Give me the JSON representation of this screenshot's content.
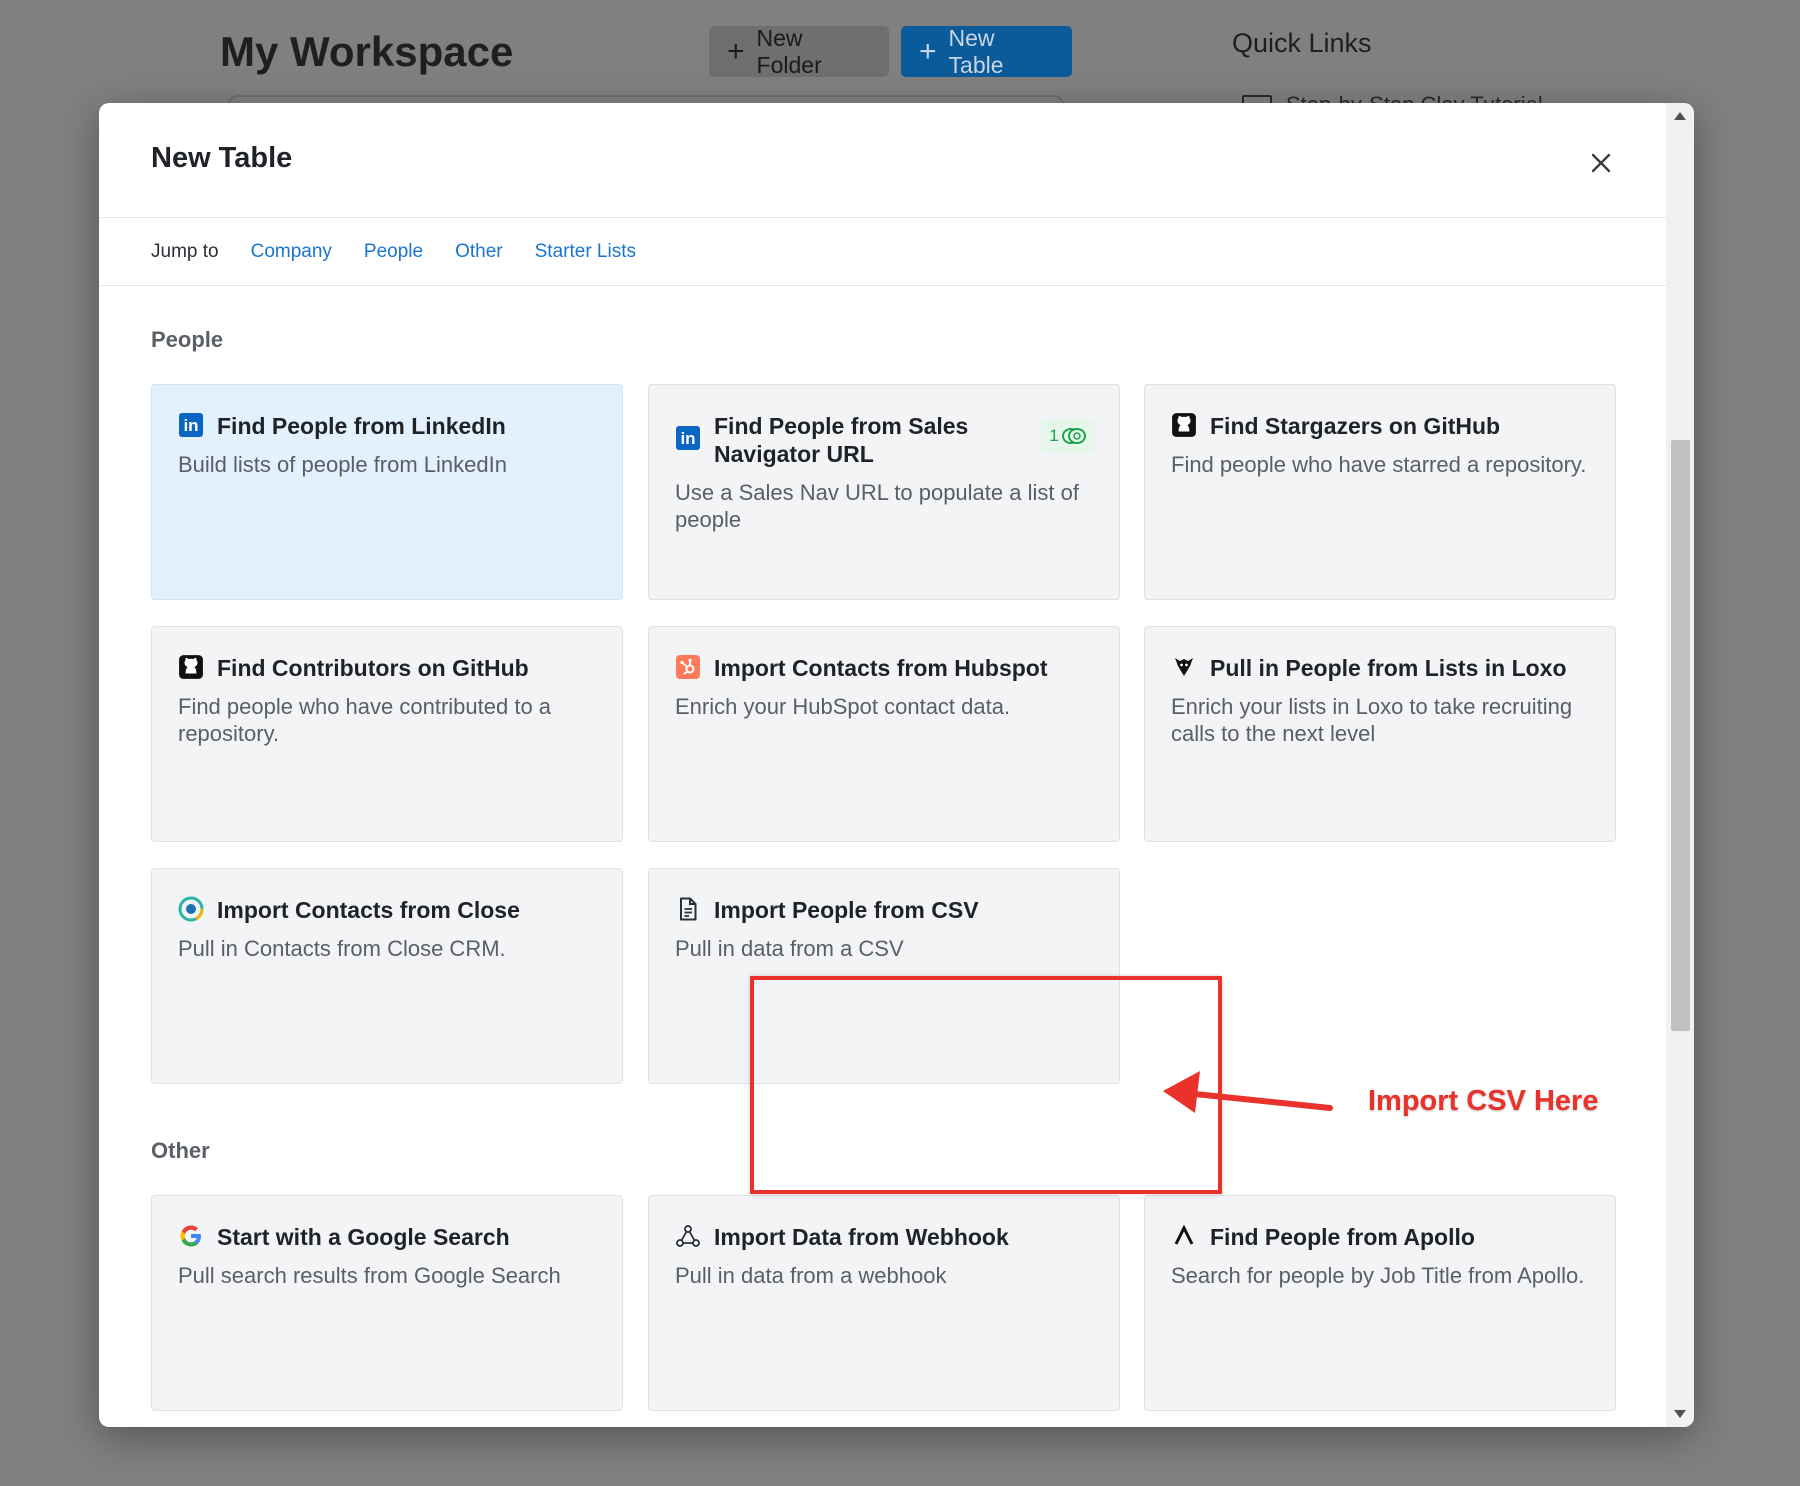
{
  "background": {
    "title": "My Workspace",
    "new_folder_label": "New Folder",
    "new_table_label": "New Table",
    "quick_links_title": "Quick Links",
    "quick_link_1": "Step-by-Step Clay Tutorial"
  },
  "modal": {
    "title": "New Table",
    "jump": {
      "label": "Jump to",
      "links": [
        "Company",
        "People",
        "Other",
        "Starter Lists"
      ]
    },
    "sections": [
      {
        "heading": "People",
        "cards": [
          {
            "icon": "linkedin-icon",
            "title": "Find People from LinkedIn",
            "desc": "Build lists of people from LinkedIn",
            "highlighted": true
          },
          {
            "icon": "linkedin-icon",
            "title": "Find People from Sales Navigator URL",
            "desc": "Use a Sales Nav URL to populate a list of people",
            "credits": "1"
          },
          {
            "icon": "github-icon",
            "title": "Find Stargazers on GitHub",
            "desc": "Find people who have starred a repository."
          },
          {
            "icon": "github-icon",
            "title": "Find Contributors on GitHub",
            "desc": "Find people who have contributed to a repository."
          },
          {
            "icon": "hubspot-icon",
            "title": "Import Contacts from Hubspot",
            "desc": "Enrich your HubSpot contact data."
          },
          {
            "icon": "loxo-icon",
            "title": "Pull in People from Lists in Loxo",
            "desc": "Enrich your lists in Loxo to take recruiting calls to the next level"
          },
          {
            "icon": "close-crm-icon",
            "title": "Import Contacts from Close",
            "desc": "Pull in Contacts from Close CRM."
          },
          {
            "icon": "document-icon",
            "title": "Import People from CSV",
            "desc": "Pull in data from a CSV"
          }
        ]
      },
      {
        "heading": "Other",
        "cards": [
          {
            "icon": "google-icon",
            "title": "Start with a Google Search",
            "desc": "Pull search results from Google Search"
          },
          {
            "icon": "webhook-icon",
            "title": "Import Data from Webhook",
            "desc": "Pull in data from a webhook"
          },
          {
            "icon": "apollo-icon",
            "title": "Find People from Apollo",
            "desc": "Search for people by Job Title from Apollo."
          }
        ]
      }
    ]
  },
  "annotation": {
    "label": "Import CSV Here",
    "color": "#e8322b"
  },
  "colors": {
    "link_blue": "#1b75d0",
    "card_bg": "#f3f4f6",
    "highlight_bg": "#e3f1fc",
    "credit_green": "#1fa34a"
  }
}
